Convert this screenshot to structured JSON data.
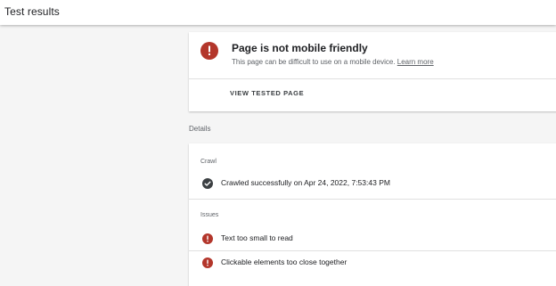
{
  "header": {
    "title": "Test results"
  },
  "status": {
    "title": "Page is not mobile friendly",
    "description": "This page can be difficult to use on a mobile device.",
    "learn_more": "Learn more",
    "action": "VIEW TESTED PAGE",
    "icon": "error-icon",
    "icon_color": "#b3362b"
  },
  "details": {
    "label": "Details",
    "crawl": {
      "label": "Crawl",
      "text": "Crawled successfully on Apr 24, 2022, 7:53:43 PM",
      "icon": "check-circle-icon",
      "icon_color": "#3c4043"
    },
    "issues": {
      "label": "Issues",
      "items": [
        {
          "text": "Text too small to read",
          "icon": "error-icon"
        },
        {
          "text": "Clickable elements too close together",
          "icon": "error-icon"
        }
      ],
      "icon_color": "#b3362b"
    }
  }
}
